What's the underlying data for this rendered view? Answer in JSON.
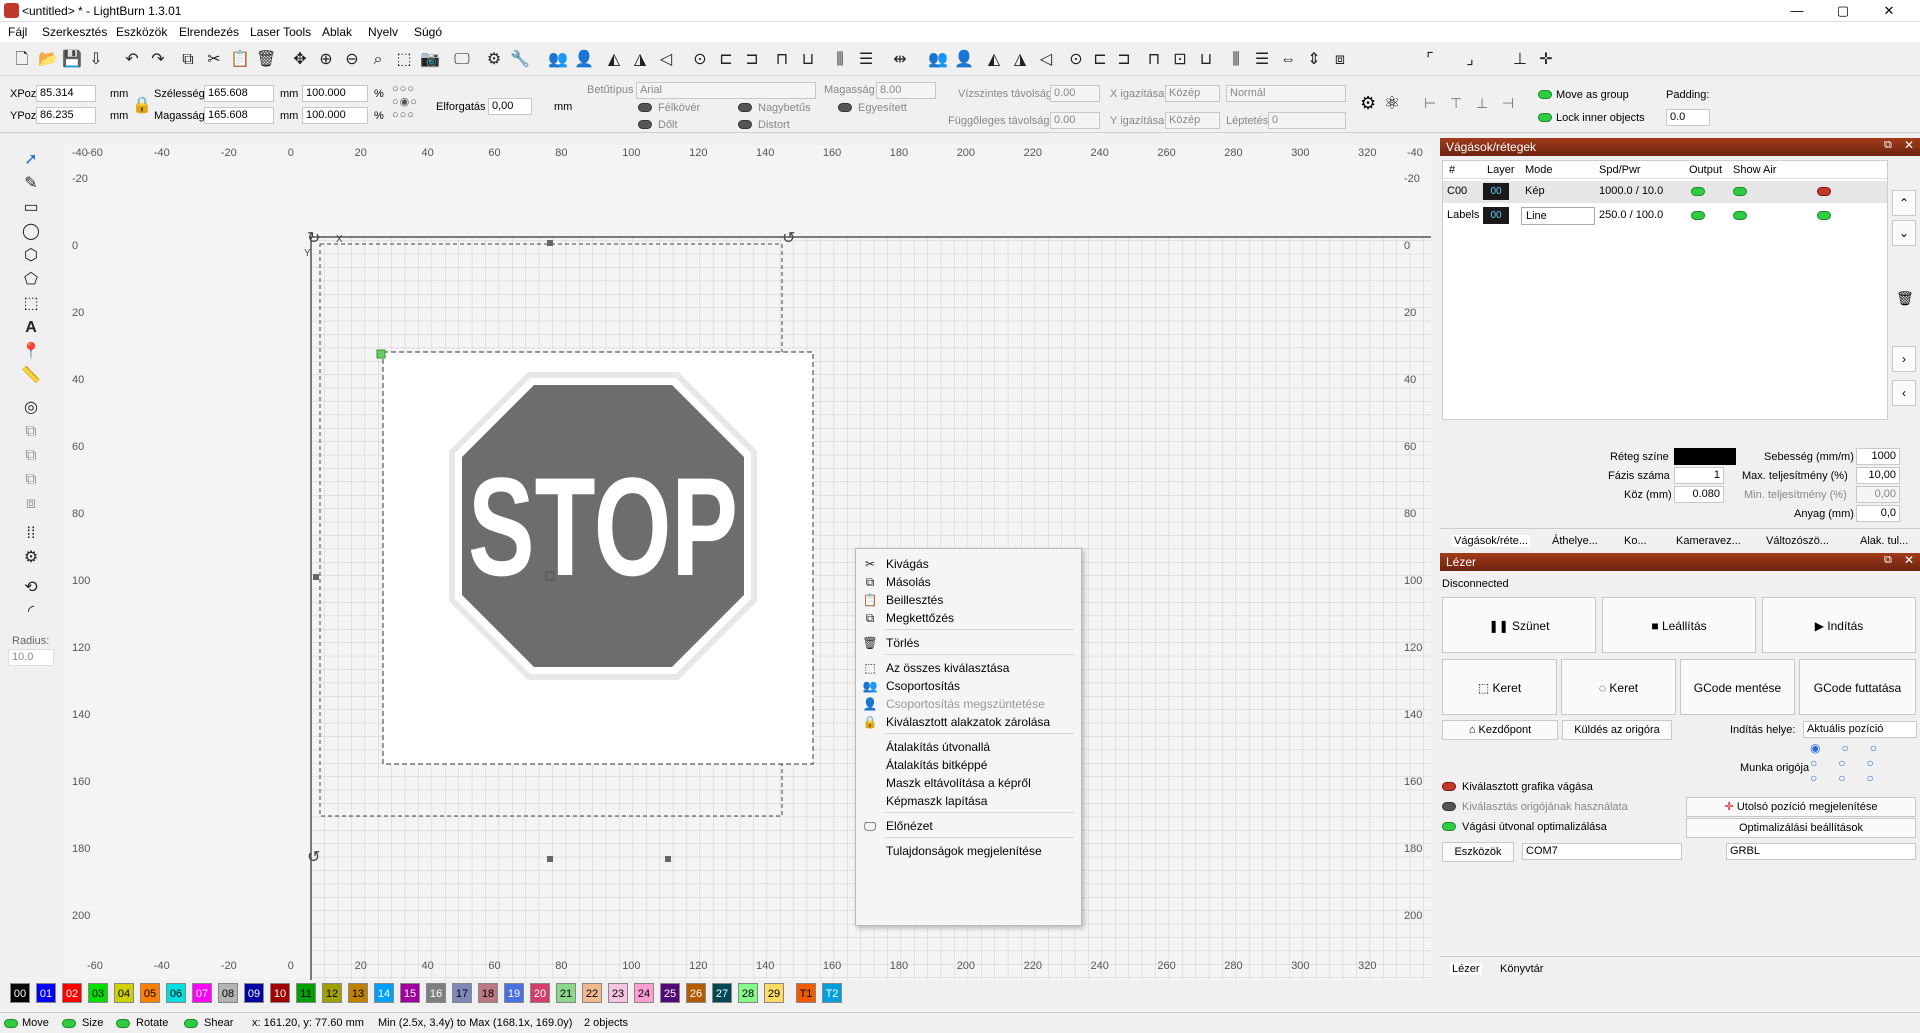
{
  "window": {
    "title": "<untitled> * - LightBurn 1.3.01",
    "minimize": "—",
    "maximize": "▢",
    "close": "✕"
  },
  "menu": [
    "Fájl",
    "Szerkesztés",
    "Eszközök",
    "Elrendezés",
    "Laser Tools",
    "Ablak",
    "Nyelv",
    "Súgó"
  ],
  "props": {
    "xpos_label": "XPoz",
    "xpos_value": "85.314",
    "ypos_label": "YPoz",
    "ypos_value": "86.235",
    "mm": "mm",
    "width_label": "Szélesség",
    "width_value": "165.608",
    "height_label": "Magasság",
    "height_value": "165.608",
    "scale_x": "100.000",
    "scale_y": "100.000",
    "percent": "%",
    "rotation_label": "Elforgatás",
    "rotation_value": "0,00",
    "rotation_unit": "mm",
    "font_label": "Betűtípus",
    "font_value": "Arial",
    "text_height_label": "Magasság",
    "text_height_value": "8.00",
    "bold": "Félkövér",
    "italic": "Dőlt",
    "upper": "Nagybetűs",
    "distort": "Distort",
    "welded": "Egyesített",
    "hspace_label": "Vízszintes távolság",
    "hspace_value": "0.00",
    "vspace_label": "Függőleges távolság",
    "vspace_value": "0.00",
    "xalign_label": "X igazítása",
    "xalign_value": "Közép",
    "yalign_label": "Y igazítása",
    "yalign_value": "Közép",
    "normal_value": "Normál",
    "offset_label": "Léptetés",
    "offset_value": "0",
    "move_group": "Move as group",
    "lock_inner": "Lock inner objects",
    "padding_label": "Padding:",
    "padding_value": "0.0"
  },
  "toolbox": {
    "radius_label": "Radius:",
    "radius_value": "10.0"
  },
  "rulers": {
    "top": [
      "-40",
      "-60",
      "-40",
      "-20",
      "0",
      "20",
      "40",
      "60",
      "80",
      "100",
      "120",
      "140",
      "160",
      "180",
      "200",
      "220",
      "240",
      "260",
      "280",
      "300",
      "320",
      "-40"
    ],
    "left": [
      "-20",
      "0",
      "20",
      "40",
      "60",
      "80",
      "100",
      "120",
      "140",
      "160",
      "180",
      "200"
    ],
    "right": [
      "-20",
      "0",
      "20",
      "40",
      "60",
      "80",
      "100",
      "120",
      "140",
      "160",
      "180",
      "200"
    ],
    "bottom": [
      "-60",
      "-40",
      "-20",
      "0",
      "20",
      "40",
      "60",
      "80",
      "100",
      "120",
      "140",
      "160",
      "180",
      "200",
      "220",
      "240",
      "260",
      "280",
      "300",
      "320"
    ]
  },
  "canvas": {
    "stop_text": "STOP",
    "x_marker": "X",
    "y_marker": "Y"
  },
  "context_menu": [
    {
      "label": "Kivágás",
      "icon": "✂",
      "dim": false
    },
    {
      "label": "Másolás",
      "icon": "⧉",
      "dim": false
    },
    {
      "label": "Beillesztés",
      "icon": "📋",
      "dim": false
    },
    {
      "label": "Megkettőzés",
      "icon": "⧉",
      "dim": false
    },
    {
      "label": "Törlés",
      "icon": "🗑",
      "dim": false
    },
    {
      "label": "Az összes kiválasztása",
      "icon": "⬚",
      "dim": false
    },
    {
      "label": "Csoportosítás",
      "icon": "👥",
      "dim": false
    },
    {
      "label": "Csoportosítás megszüntetése",
      "icon": "👤",
      "dim": true
    },
    {
      "label": "Kiválasztott alakzatok zárolása",
      "icon": "🔒",
      "dim": false
    },
    {
      "label": "Átalakítás útvonallá",
      "icon": "",
      "dim": false
    },
    {
      "label": "Átalakítás bitképpé",
      "icon": "",
      "dim": false
    },
    {
      "label": "Maszk eltávolítása a képről",
      "icon": "",
      "dim": false
    },
    {
      "label": "Képmaszk lapítása",
      "icon": "",
      "dim": false
    },
    {
      "label": "Előnézet",
      "icon": "🖵",
      "dim": false
    },
    {
      "label": "Tulajdonságok megjelenítése",
      "icon": "",
      "dim": false
    }
  ],
  "layers_panel": {
    "title": "Vágások/rétegek",
    "headers": [
      "#",
      "Layer",
      "Mode",
      "Spd/Pwr",
      "Output",
      "Show",
      "Air"
    ],
    "rows": [
      {
        "name": "C00",
        "layer": "00",
        "mode": "Kép",
        "spdpwr": "1000.0 / 10.0"
      },
      {
        "name": "Labels",
        "layer": "00",
        "mode": "Line",
        "spdpwr": "250.0 / 100.0"
      }
    ],
    "layer_color_label": "Réteg színe",
    "passes_label": "Fázis száma",
    "passes_value": "1",
    "interval_label": "Köz (mm)",
    "interval_value": "0.080",
    "speed_label": "Sebesség (mm/m)",
    "speed_value": "1000",
    "maxpower_label": "Max. teljesítmény (%)",
    "maxpower_value": "10,00",
    "minpower_label": "Min. teljesítmény (%)",
    "minpower_value": "0,00",
    "material_label": "Anyag (mm)",
    "material_value": "0,0",
    "tabs": [
      "Vágások/réte...",
      "Áthelye...",
      "Ko...",
      "Kameravez...",
      "Változószö...",
      "Alak. tul..."
    ]
  },
  "laser_panel": {
    "title": "Lézer",
    "status": "Disconnected",
    "pause": "Szünet",
    "stop": "Leállítás",
    "start": "Indítás",
    "frame1": "Keret",
    "frame2": "Keret",
    "save_gcode": "GCode mentése",
    "run_gcode": "GCode futtatása",
    "home": "Kezdőpont",
    "go_origin": "Küldés az origóra",
    "start_from_label": "Indítás helye:",
    "start_from_value": "Aktuális pozíció",
    "job_origin_label": "Munka origója",
    "cut_selected": "Kiválasztott grafika vágása",
    "use_sel_origin": "Kiválasztás origójának használata",
    "optimize": "Vágási útvonal optimalizálása",
    "last_pos": "Utolsó pozíció megjelenítése",
    "opt_settings": "Optimalizálási beállítások",
    "devices": "Eszközök",
    "port": "COM7",
    "controller": "GRBL",
    "tab_laser": "Lézer",
    "tab_library": "Könyvtár"
  },
  "palette": [
    {
      "label": "00",
      "color": "#000000",
      "fg": "#ffffff"
    },
    {
      "label": "01",
      "color": "#0000ff",
      "fg": "#ffffff"
    },
    {
      "label": "02",
      "color": "#ff0000",
      "fg": "#ffffff"
    },
    {
      "label": "03",
      "color": "#00e000",
      "fg": "#000000"
    },
    {
      "label": "04",
      "color": "#d0d000",
      "fg": "#000000"
    },
    {
      "label": "05",
      "color": "#ff8000",
      "fg": "#000000"
    },
    {
      "label": "06",
      "color": "#00e0e0",
      "fg": "#000000"
    },
    {
      "label": "07",
      "color": "#ff00ff",
      "fg": "#ffffff"
    },
    {
      "label": "08",
      "color": "#b4b4b4",
      "fg": "#000000"
    },
    {
      "label": "09",
      "color": "#0000a0",
      "fg": "#ffffff"
    },
    {
      "label": "10",
      "color": "#a00000",
      "fg": "#ffffff"
    },
    {
      "label": "11",
      "color": "#00a000",
      "fg": "#000000"
    },
    {
      "label": "12",
      "color": "#a0a000",
      "fg": "#000000"
    },
    {
      "label": "13",
      "color": "#c08000",
      "fg": "#000000"
    },
    {
      "label": "14",
      "color": "#00a0ff",
      "fg": "#ffffff"
    },
    {
      "label": "15",
      "color": "#a000a0",
      "fg": "#ffffff"
    },
    {
      "label": "16",
      "color": "#808080",
      "fg": "#ffffff"
    },
    {
      "label": "17",
      "color": "#7d87b9",
      "fg": "#000000"
    },
    {
      "label": "18",
      "color": "#bb7784",
      "fg": "#000000"
    },
    {
      "label": "19",
      "color": "#4a6fe3",
      "fg": "#ffffff"
    },
    {
      "label": "20",
      "color": "#d33f6a",
      "fg": "#ffffff"
    },
    {
      "label": "21",
      "color": "#8cd78c",
      "fg": "#000000"
    },
    {
      "label": "22",
      "color": "#f0b98d",
      "fg": "#000000"
    },
    {
      "label": "23",
      "color": "#f6c4e1",
      "fg": "#000000"
    },
    {
      "label": "24",
      "color": "#fa9ed4",
      "fg": "#000000"
    },
    {
      "label": "25",
      "color": "#500a78",
      "fg": "#ffffff"
    },
    {
      "label": "26",
      "color": "#b45a00",
      "fg": "#ffffff"
    },
    {
      "label": "27",
      "color": "#004754",
      "fg": "#ffffff"
    },
    {
      "label": "28",
      "color": "#86fa88",
      "fg": "#000000"
    },
    {
      "label": "29",
      "color": "#ffdb66",
      "fg": "#000000"
    },
    {
      "label": "T1",
      "color": "#f05a00",
      "fg": "#000000"
    },
    {
      "label": "T2",
      "color": "#00a0e0",
      "fg": "#ffffff"
    }
  ],
  "status": {
    "move": "Move",
    "size": "Size",
    "rotate": "Rotate",
    "shear": "Shear",
    "coords": "x: 161.20, y: 77.60 mm",
    "bounds": "Min (2.5x, 3.4y) to Max (168.1x, 169.0y)",
    "objects": "2 objects"
  }
}
